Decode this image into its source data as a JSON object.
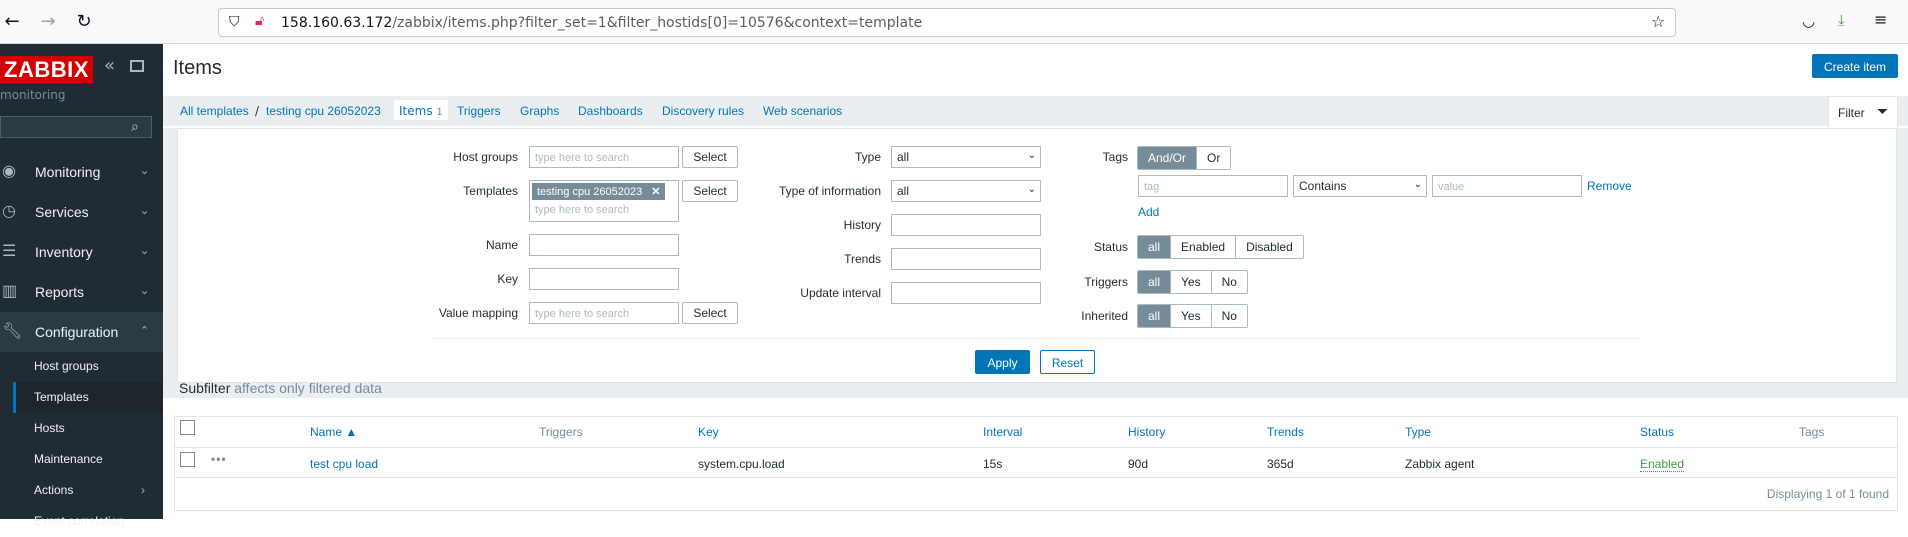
{
  "browser": {
    "url_host": "158.160.63.172",
    "url_path": "/zabbix/items.php?filter_set=1&filter_hostids[0]=10576&context=template"
  },
  "sidebar": {
    "logo": "ZABBIX",
    "subtitle": "monitoring",
    "menu": [
      {
        "label": "Monitoring",
        "icon": "eye-icon"
      },
      {
        "label": "Services",
        "icon": "clock-icon"
      },
      {
        "label": "Inventory",
        "icon": "list-icon"
      },
      {
        "label": "Reports",
        "icon": "chart-icon"
      },
      {
        "label": "Configuration",
        "icon": "wrench-icon"
      }
    ],
    "submenu": [
      "Host groups",
      "Templates",
      "Hosts",
      "Maintenance",
      "Actions",
      "Event correlation"
    ]
  },
  "header": {
    "title": "Items",
    "create_button": "Create item"
  },
  "breadcrumbs": {
    "all_templates": "All templates",
    "separator": "/",
    "template": "testing cpu 26052023",
    "items": "Items",
    "items_count": "1",
    "tabs": [
      "Triggers",
      "Graphs",
      "Dashboards",
      "Discovery rules",
      "Web scenarios"
    ]
  },
  "filter": {
    "tab_label": "Filter",
    "host_groups_label": "Host groups",
    "host_groups_placeholder": "type here to search",
    "templates_label": "Templates",
    "templates_chip": "testing cpu 26052023",
    "templates_placeholder": "type here to search",
    "select_label": "Select",
    "name_label": "Name",
    "key_label": "Key",
    "value_mapping_label": "Value mapping",
    "value_mapping_placeholder": "type here to search",
    "type_label": "Type",
    "type_value": "all",
    "type_info_label": "Type of information",
    "type_info_value": "all",
    "history_label": "History",
    "trends_label": "Trends",
    "update_interval_label": "Update interval",
    "tags_label": "Tags",
    "tags_andor": "And/Or",
    "tags_or": "Or",
    "tag_placeholder": "tag",
    "tag_operator": "Contains",
    "tag_value_placeholder": "value",
    "remove_label": "Remove",
    "add_label": "Add",
    "status_label": "Status",
    "status_options": [
      "all",
      "Enabled",
      "Disabled"
    ],
    "triggers_label": "Triggers",
    "triggers_options": [
      "all",
      "Yes",
      "No"
    ],
    "inherited_label": "Inherited",
    "inherited_options": [
      "all",
      "Yes",
      "No"
    ],
    "apply_label": "Apply",
    "reset_label": "Reset"
  },
  "subfilter": {
    "title": "Subfilter",
    "note": "affects only filtered data"
  },
  "table": {
    "headers": {
      "name": "Name ▲",
      "triggers": "Triggers",
      "key": "Key",
      "interval": "Interval",
      "history": "History",
      "trends": "Trends",
      "type": "Type",
      "status": "Status",
      "tags": "Tags"
    },
    "rows": [
      {
        "name": "test cpu load",
        "key": "system.cpu.load",
        "interval": "15s",
        "history": "90d",
        "trends": "365d",
        "type": "Zabbix agent",
        "status": "Enabled"
      }
    ],
    "footer": "Displaying 1 of 1 found"
  }
}
